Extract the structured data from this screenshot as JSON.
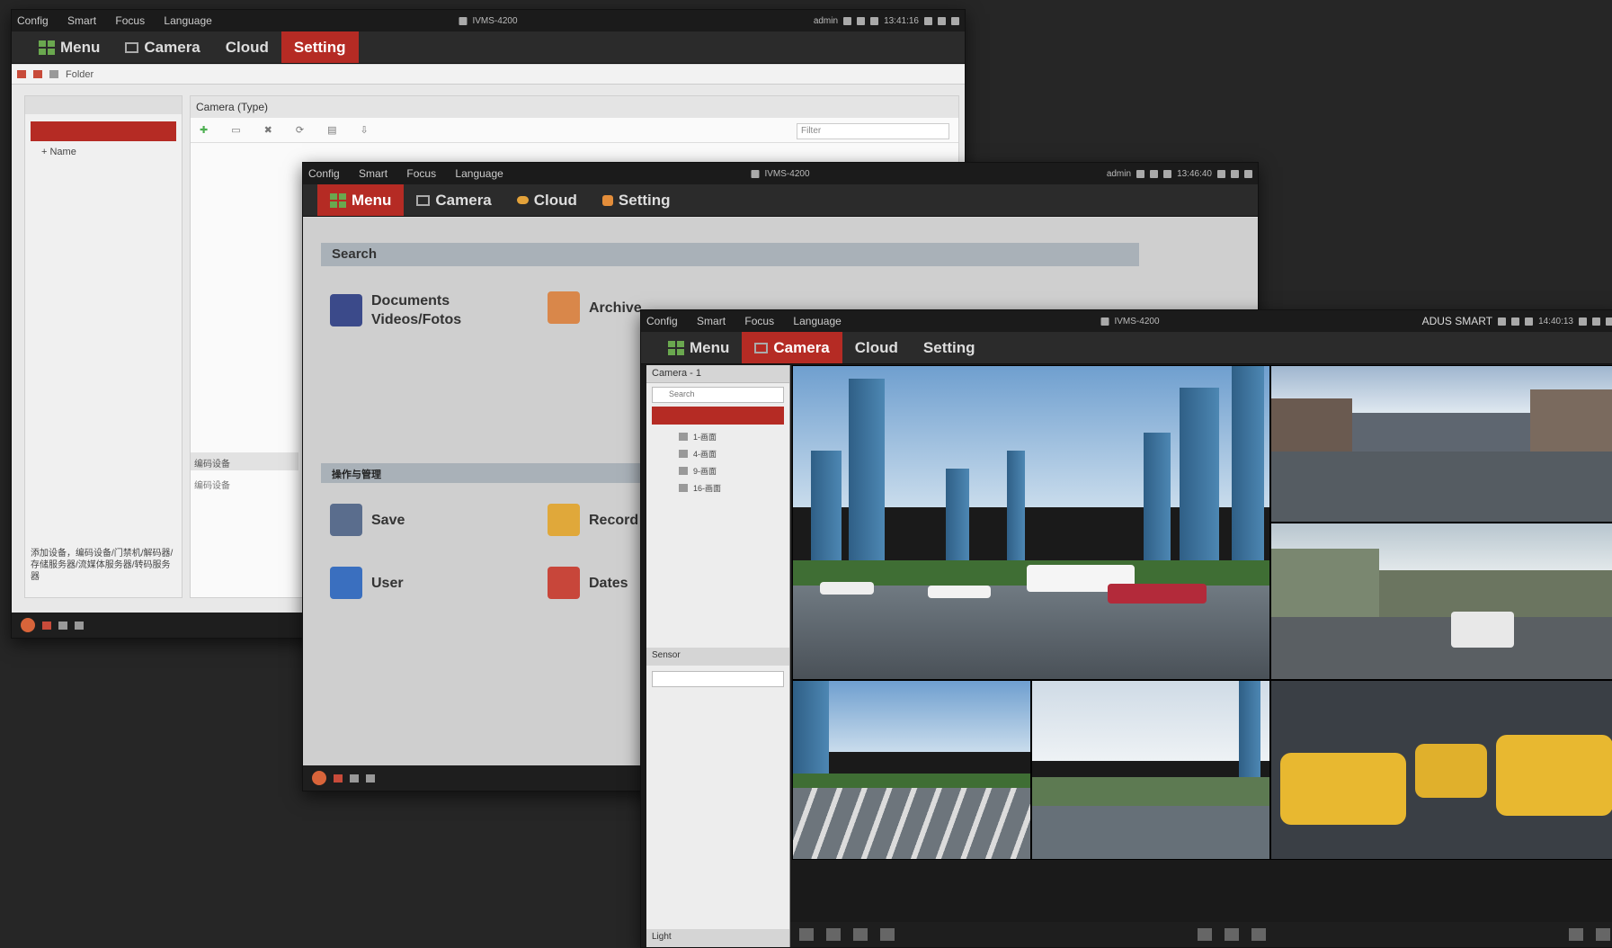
{
  "menu_top": [
    "Config",
    "Smart",
    "Focus",
    "Language"
  ],
  "app_title": "IVMS-4200",
  "nav": {
    "menu": "Menu",
    "camera": "Camera",
    "cloud": "Cloud",
    "setting": "Setting"
  },
  "w1": {
    "time": "13:41:16",
    "user": "admin",
    "breadcrumb": "Folder",
    "tree_item": "Name",
    "pane_title": "Camera (Type)",
    "filter_placeholder": "Filter",
    "sub_title": "编码设备",
    "sub_row": "编码设备",
    "note": "添加设备，编码设备/门禁机/解码器/存储服务器/流媒体服务器/转码服务器"
  },
  "w2": {
    "time": "13:46:40",
    "user": "admin",
    "search_label": "Search",
    "section2_label": "操作与管理",
    "tiles": [
      {
        "line1": "Documents",
        "line2": "Videos/Fotos",
        "icon_color": "#3b4a8a"
      },
      {
        "line1": "Archive",
        "line2": "",
        "icon_color": "#d9874a"
      },
      {
        "line1": "Save",
        "line2": "",
        "icon_color": "#5a6d8d"
      },
      {
        "line1": "Record",
        "line2": "",
        "icon_color": "#e0a83a"
      },
      {
        "line1": "User",
        "line2": "",
        "icon_color": "#3a6fbf"
      },
      {
        "line1": "Dates",
        "line2": "",
        "icon_color": "#c8463a"
      }
    ]
  },
  "w3": {
    "brand": "ADUS SMART",
    "time": "14:40:13",
    "camera_header": "Camera - 1",
    "search_placeholder": "Search",
    "tree": [
      "1-画面",
      "4-画面",
      "9-画面",
      "16-画面"
    ],
    "section_sensor": "Sensor",
    "section_light": "Light"
  },
  "colors": {
    "accent": "#b52b24",
    "bar": "#2b2b2b"
  }
}
